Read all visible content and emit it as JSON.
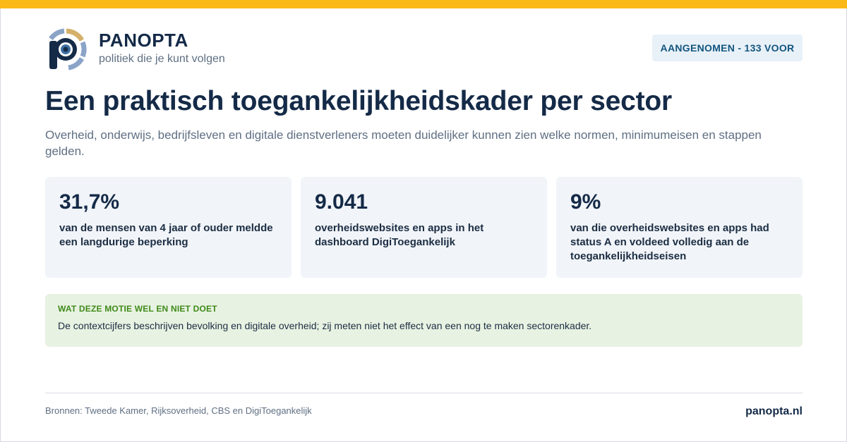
{
  "brand": {
    "name": "PANOPTA",
    "tagline": "politiek die je kunt volgen",
    "logo_icon": "eye-logo-icon",
    "colors": {
      "dark": "#142a47",
      "gold": "#d4b06a",
      "blue": "#8aa4c8",
      "pupil": "#3d6fa3"
    }
  },
  "badge": {
    "label": "AANGENOMEN - 133 VOOR"
  },
  "title": "Een praktisch toegankelijkheidskader per sector",
  "subtitle": "Overheid, onderwijs, bedrijfsleven en digitale dienstverleners moeten duidelijker kunnen zien welke normen, minimumeisen en stappen gelden.",
  "stats": [
    {
      "value": "31,7%",
      "label": "van de mensen van 4 jaar of ouder meldde een langdurige beperking"
    },
    {
      "value": "9.041",
      "label": "overheidswebsites en apps in het dashboard DigiToegankelijk"
    },
    {
      "value": "9%",
      "label": "van die overheidswebsites en apps had status A en voldeed volledig aan de toegankelijkheidseisen"
    }
  ],
  "note": {
    "title": "WAT DEZE MOTIE WEL EN NIET DOET",
    "text": "De contextcijfers beschrijven bevolking en digitale overheid; zij meten niet het effect van een nog te maken sectorenkader."
  },
  "footer": {
    "sources": "Bronnen: Tweede Kamer, Rijksoverheid, CBS en DigiToegankelijk",
    "site": "panopta.nl"
  },
  "accent_colors": {
    "top_bar": "#fbb917",
    "badge_bg": "#e8f1f8",
    "note_bg": "#e8f2e2",
    "note_title": "#3f8a1a"
  }
}
